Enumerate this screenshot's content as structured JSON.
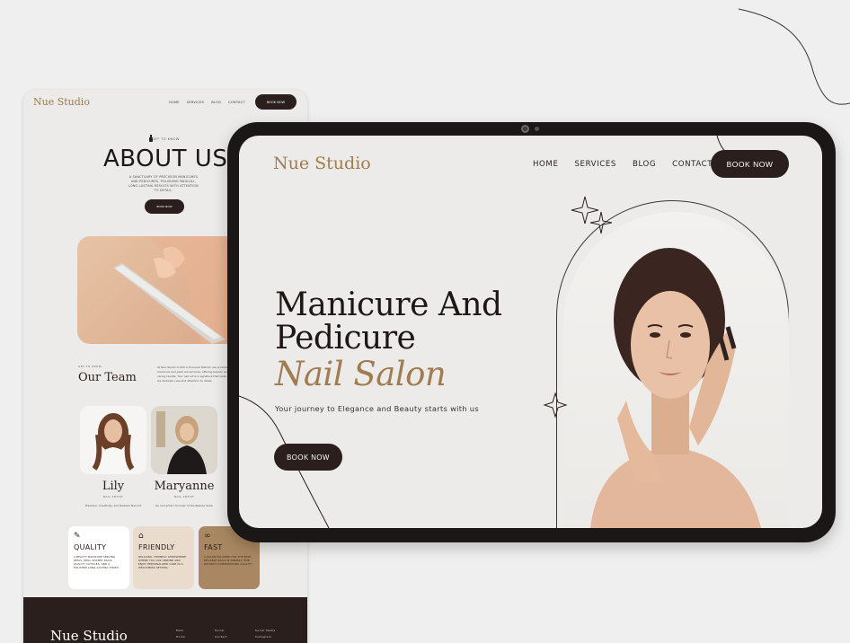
{
  "phone": {
    "logo": "Nue Studio",
    "nav": [
      "HOME",
      "SERVICES",
      "BLOG",
      "CONTACT"
    ],
    "book_button": "BOOK NOW",
    "about_small": "GET TO KNOW",
    "about_title": "ABOUT US",
    "about_desc": "A SANCTUARY OF PRECISION MANICURES AND PEDICURES, POLISHING MAGICAL, LONG-LASTING RESULTS WITH ATTENTION TO DETAIL.",
    "about_button": "BOOK NOW",
    "team_small": "GET TO KNOW",
    "team_title": "Our Team",
    "team_text": "At Nue Studio in NYC's Financial District, we provide manicure and pedicure services, offering beauty and caring results. Your nail art is a signature that lasts, we dedicate care and attention to detail.",
    "members": [
      {
        "name": "Lily",
        "role": "NAIL ARTIST",
        "desc": "Precision, Creativity, and Relaxed Nail Art"
      },
      {
        "name": "Maryanne",
        "role": "NAIL ARTIST",
        "desc": "Lip nail artist / founder of the Beauty Salon"
      }
    ],
    "features": [
      {
        "icon": "nail-polish-icon",
        "title": "QUALITY",
        "text": "A BEAUTY MANICURE SERVING IDEAS, WELL SHAPED NAILS, QUALITY CUTICLES, AND A POLISHED LONG-LASTING FINISH."
      },
      {
        "icon": "home-icon",
        "title": "FRIENDLY",
        "text": "RELAXING, FRIENDLY ATMOSPHERE WHERE YOU CAN UNWIND AND ENJOY PERSONALIZED CARE IN A WELCOMING SETTING."
      },
      {
        "icon": "infinity-icon",
        "title": "FAST",
        "text": "A SALON POLISHED FOR THE BEST, RELIABLE NAILS IN MINIMAL TIME WITHOUT COMPROMISING QUALITY."
      }
    ],
    "footer": {
      "logo": "Nue Studio",
      "cols": [
        {
          "head": "Main",
          "item": "Home"
        },
        {
          "head": "Social",
          "item": "Contact"
        },
        {
          "head": "Social Media",
          "item": "Instagram"
        }
      ]
    }
  },
  "tablet": {
    "logo": "Nue Studio",
    "nav": [
      "HOME",
      "SERVICES",
      "BLOG",
      "CONTACT"
    ],
    "book_button": "BOOK NOW",
    "hero": {
      "line1": "Manicure And",
      "line2": "Pedicure",
      "line3": "Nail Salon",
      "tagline": "Your journey to Elegance and Beauty starts with us",
      "cta": "BOOK NOW"
    }
  },
  "colors": {
    "accent_gold": "#a07c4f",
    "dark_brown": "#2a1f1d",
    "background": "#ecebe9"
  }
}
